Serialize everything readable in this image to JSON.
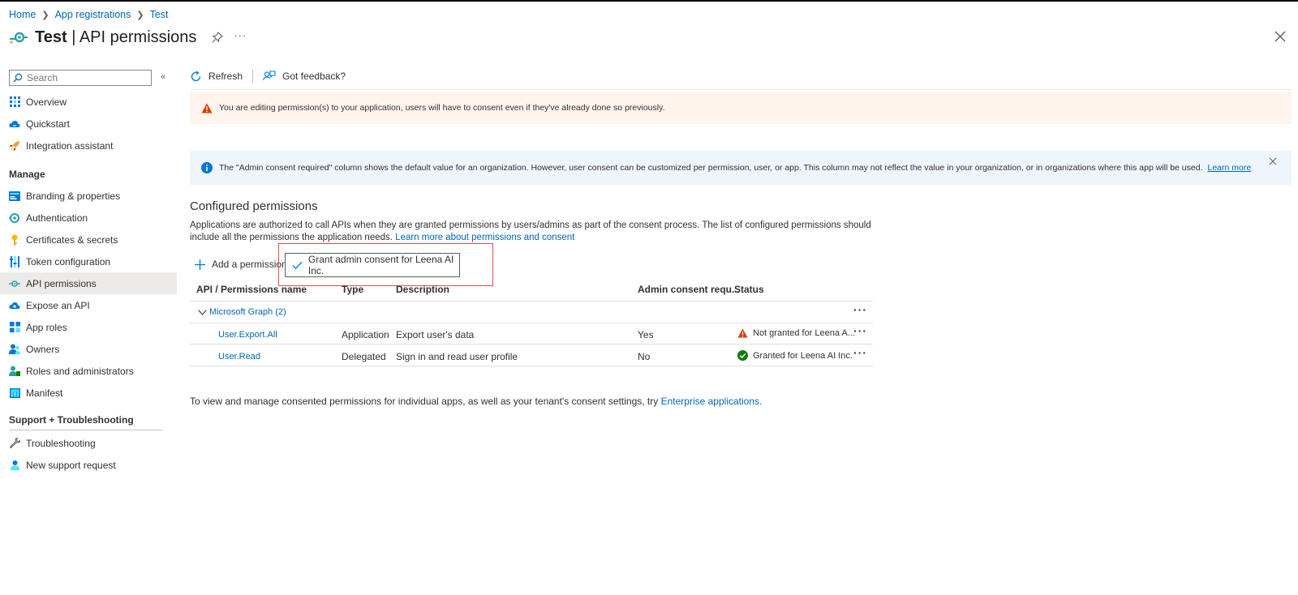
{
  "breadcrumb": [
    {
      "label": "Home"
    },
    {
      "label": "App registrations"
    },
    {
      "label": "Test"
    }
  ],
  "header": {
    "app_name": "Test",
    "title_suffix": " | API permissions",
    "more": "···"
  },
  "sidebar": {
    "search_placeholder": "Search",
    "top_items": [
      {
        "label": "Overview",
        "icon": "overview-icon"
      },
      {
        "label": "Quickstart",
        "icon": "quickstart-icon"
      },
      {
        "label": "Integration assistant",
        "icon": "rocket-icon"
      }
    ],
    "manage_label": "Manage",
    "manage_items": [
      {
        "label": "Branding & properties",
        "icon": "branding-icon"
      },
      {
        "label": "Authentication",
        "icon": "authentication-icon"
      },
      {
        "label": "Certificates & secrets",
        "icon": "key-icon"
      },
      {
        "label": "Token configuration",
        "icon": "token-icon"
      },
      {
        "label": "API permissions",
        "icon": "api-permissions-icon",
        "selected": true
      },
      {
        "label": "Expose an API",
        "icon": "cloud-icon"
      },
      {
        "label": "App roles",
        "icon": "app-roles-icon"
      },
      {
        "label": "Owners",
        "icon": "owners-icon"
      },
      {
        "label": "Roles and administrators",
        "icon": "roles-icon"
      },
      {
        "label": "Manifest",
        "icon": "manifest-icon"
      }
    ],
    "support_label": "Support + Troubleshooting",
    "support_items": [
      {
        "label": "Troubleshooting",
        "icon": "wrench-icon"
      },
      {
        "label": "New support request",
        "icon": "support-icon"
      }
    ]
  },
  "toolbar": {
    "refresh": "Refresh",
    "feedback": "Got feedback?"
  },
  "warning_banner": {
    "text": "You are editing permission(s) to your application, users will have to consent even if they've already done so previously."
  },
  "info_banner": {
    "text": "The \"Admin consent required\" column shows the default value for an organization. However, user consent can be customized per permission, user, or app. This column may not reflect the value in your organization, or in organizations where this app will be used.",
    "link": "Learn more"
  },
  "configured": {
    "title": "Configured permissions",
    "desc": "Applications are authorized to call APIs when they are granted permissions by users/admins as part of the consent process. The list of configured permissions should include all the permissions the application needs.",
    "desc_link": "Learn more about permissions and consent",
    "add_permission": "Add a permission",
    "grant_consent": "Grant admin consent for Leena AI Inc."
  },
  "table": {
    "headers": {
      "name": "API / Permissions name",
      "type": "Type",
      "description": "Description",
      "admin": "Admin consent requ...",
      "status": "Status"
    },
    "group": "Microsoft Graph (2)",
    "rows": [
      {
        "name": "User.Export.All",
        "type": "Application",
        "description": "Export user's data",
        "admin": "Yes",
        "status": "Not granted for Leena A...",
        "status_kind": "warning"
      },
      {
        "name": "User.Read",
        "type": "Delegated",
        "description": "Sign in and read user profile",
        "admin": "No",
        "status": "Granted for Leena AI Inc.",
        "status_kind": "granted"
      }
    ],
    "more": "···"
  },
  "footer": {
    "text": "To view and manage consented permissions for individual apps, as well as your tenant's consent settings, try",
    "link": "Enterprise applications",
    "period": "."
  },
  "colors": {
    "link": "#0067b8",
    "warning": "#d83b01",
    "info": "#0078d4",
    "success": "#107c10",
    "highlight": "#e34a4a"
  }
}
